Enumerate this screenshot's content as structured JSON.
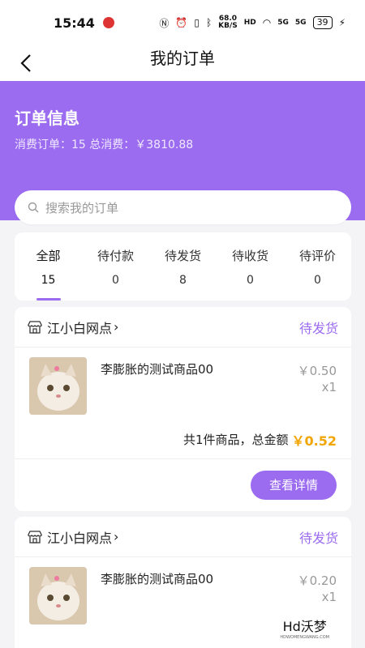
{
  "status_bar": {
    "time": "15:44",
    "network_speed_value": "68.0",
    "network_speed_unit": "KB/S",
    "hd_label": "HD",
    "signal_1": "5G",
    "signal_2": "5G",
    "battery": "39"
  },
  "nav": {
    "title": "我的订单"
  },
  "hero": {
    "title": "订单信息",
    "stats": "消费订单：15 总消费：￥3810.88"
  },
  "search": {
    "placeholder": "搜索我的订单"
  },
  "tabs": [
    {
      "label": "全部",
      "count": "15",
      "active": true
    },
    {
      "label": "待付款",
      "count": "0"
    },
    {
      "label": "待发货",
      "count": "8"
    },
    {
      "label": "待收货",
      "count": "0"
    },
    {
      "label": "待评价",
      "count": "0"
    }
  ],
  "orders": [
    {
      "shop": "江小白网点",
      "status": "待发货",
      "item_name": "李膨胀的测试商品00",
      "price": "￥0.50",
      "qty": "x1",
      "summary": "共1件商品，总金额",
      "total": "￥0.52",
      "detail_label": "查看详情"
    },
    {
      "shop": "江小白网点",
      "status": "待发货",
      "item_name": "李膨胀的测试商品00",
      "price": "￥0.20",
      "qty": "x1"
    }
  ],
  "watermark": {
    "text": "Hd沃梦",
    "sub": "HDWOMENGWANG.COM"
  },
  "colors": {
    "accent": "#9b6bf0",
    "price_highlight": "#f0a500"
  }
}
